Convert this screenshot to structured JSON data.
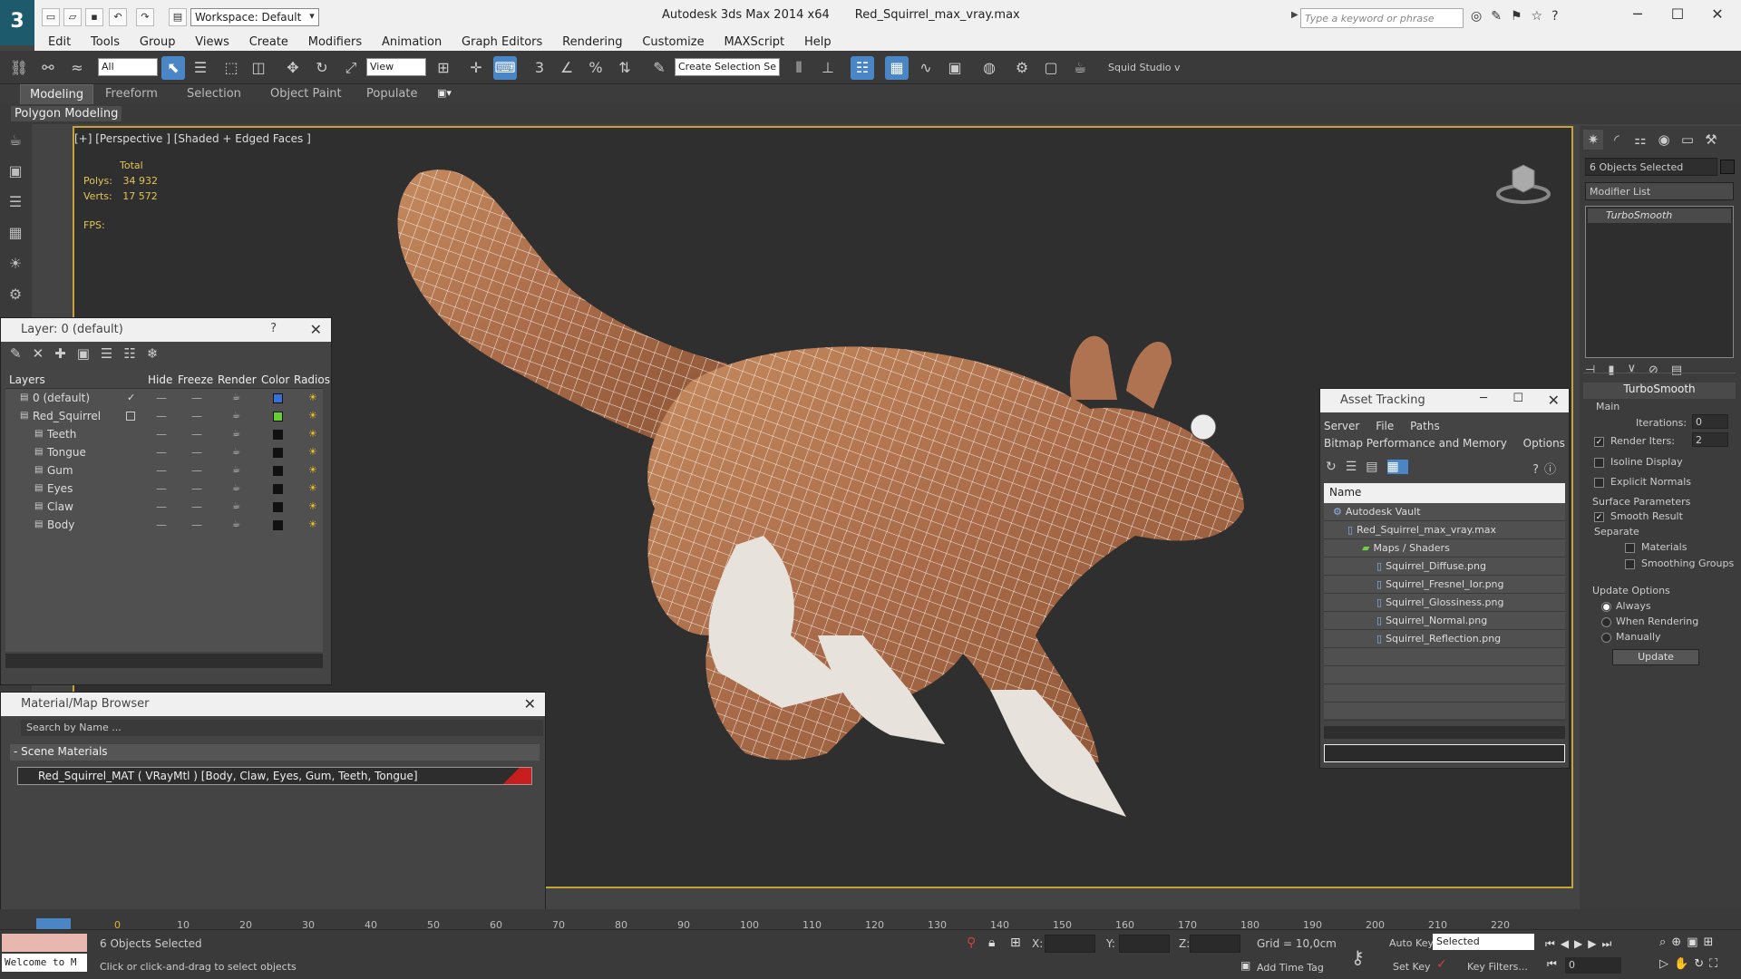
{
  "app": {
    "workspace": "Workspace: Default",
    "title": "Autodesk 3ds Max  2014 x64",
    "filename": "Red_Squirrel_max_vray.max",
    "search_placeholder": "Type a keyword or phrase"
  },
  "menu": [
    "Edit",
    "Tools",
    "Group",
    "Views",
    "Create",
    "Modifiers",
    "Animation",
    "Graph Editors",
    "Rendering",
    "Customize",
    "MAXScript",
    "Help"
  ],
  "toolbar": {
    "selection_filter": "All",
    "ref_coord": "View",
    "named_selection": "Create Selection Se",
    "studio": "Squid Studio v"
  },
  "ribbon": {
    "tabs": [
      "Modeling",
      "Freeform",
      "Selection",
      "Object Paint",
      "Populate"
    ],
    "sub": "Polygon Modeling"
  },
  "viewport": {
    "label": "[+] [Perspective ] [Shaded + Edged Faces ]",
    "stats_total": "Total",
    "polys_label": "Polys:",
    "polys_value": "34 932",
    "verts_label": "Verts:",
    "verts_value": "17 572",
    "fps_label": "FPS:"
  },
  "layer_panel": {
    "title": "Layer: 0 (default)",
    "help": "?",
    "columns": [
      "Layers",
      "Hide",
      "Freeze",
      "Render",
      "Color",
      "Radios"
    ],
    "rows": [
      {
        "name": "0 (default)",
        "color": "#3a6fd8"
      },
      {
        "name": "Red_Squirrel",
        "color": "#66cc33"
      },
      {
        "name": "Teeth",
        "color": "#111111"
      },
      {
        "name": "Tongue",
        "color": "#111111"
      },
      {
        "name": "Gum",
        "color": "#111111"
      },
      {
        "name": "Eyes",
        "color": "#111111"
      },
      {
        "name": "Claw",
        "color": "#111111"
      },
      {
        "name": "Body",
        "color": "#111111"
      }
    ]
  },
  "material_browser": {
    "title": "Material/Map Browser",
    "search_placeholder": "Search by Name ...",
    "group": "- Scene Materials",
    "item": "Red_Squirrel_MAT  ( VRayMtl ) [Body, Claw, Eyes, Gum, Teeth, Tongue]"
  },
  "asset_tracking": {
    "title": "Asset Tracking",
    "menu": [
      "Server",
      "File",
      "Paths",
      "Bitmap Performance and Memory",
      "Options"
    ],
    "header": "Name",
    "items": [
      {
        "label": "Autodesk Vault",
        "indent": 0
      },
      {
        "label": "Red_Squirrel_max_vray.max",
        "indent": 1
      },
      {
        "label": "Maps / Shaders",
        "indent": 2
      },
      {
        "label": "Squirrel_Diffuse.png",
        "indent": 3
      },
      {
        "label": "Squirrel_Fresnel_Ior.png",
        "indent": 3
      },
      {
        "label": "Squirrel_Glossiness.png",
        "indent": 3
      },
      {
        "label": "Squirrel_Normal.png",
        "indent": 3
      },
      {
        "label": "Squirrel_Reflection.png",
        "indent": 3
      }
    ]
  },
  "command_panel": {
    "selection": "6 Objects Selected",
    "modifier_list": "Modifier List",
    "stack_item": "TurboSmooth",
    "rollout": "TurboSmooth",
    "main": "Main",
    "iterations_label": "Iterations:",
    "iterations_value": "0",
    "render_iters_label": "Render Iters:",
    "render_iters_value": "2",
    "isoline": "Isoline Display",
    "explicit": "Explicit Normals",
    "surface_params": "Surface Parameters",
    "smooth_result": "Smooth Result",
    "separate": "Separate",
    "materials": "Materials",
    "smoothing_groups": "Smoothing Groups",
    "update_options": "Update Options",
    "always": "Always",
    "when_rendering": "When Rendering",
    "manually": "Manually",
    "update_button": "Update"
  },
  "timeline": {
    "ticks": [
      "0",
      "10",
      "20",
      "30",
      "40",
      "50",
      "60",
      "70",
      "80",
      "90",
      "100",
      "110",
      "120",
      "130",
      "140",
      "150",
      "160",
      "170",
      "180",
      "190",
      "200",
      "210",
      "220"
    ]
  },
  "status": {
    "maxscript": "Welcome to M",
    "selected": "6 Objects Selected",
    "prompt": "Click or click-and-drag to select objects",
    "x_label": "X:",
    "y_label": "Y:",
    "z_label": "Z:",
    "grid": "Grid = 10,0cm",
    "add_time_tag": "Add Time Tag",
    "auto_key": "Auto Key",
    "set_key": "Set Key",
    "key_mode": "Selected",
    "key_filters": "Key Filters...",
    "frame": "0"
  }
}
